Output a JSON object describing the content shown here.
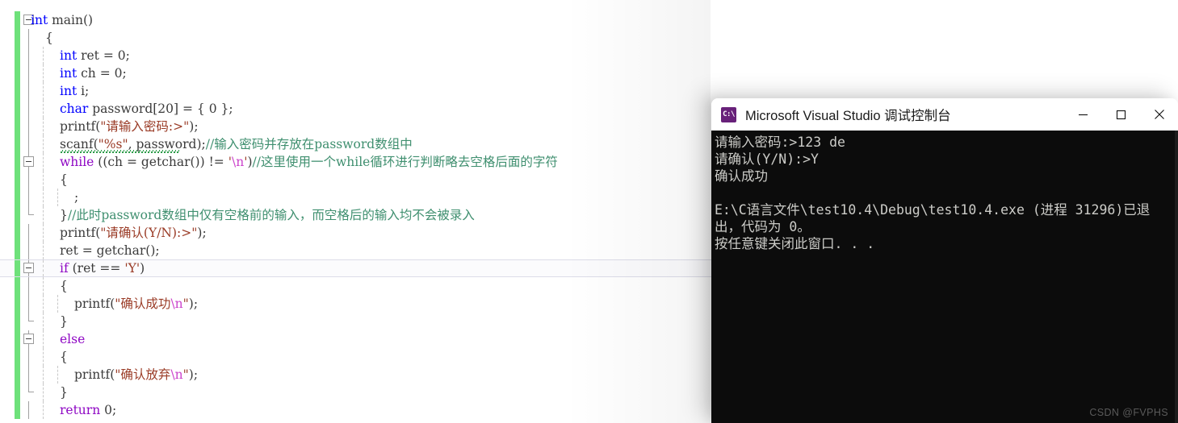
{
  "editor": {
    "name": "visual-studio-code-editor",
    "background": "#ffffff",
    "change_bar_color": "#6ee17a",
    "current_line_index": 13,
    "lines": [
      {
        "indent": 0,
        "collapse": true,
        "tokens": [
          {
            "c": "kw",
            "t": "int"
          },
          {
            "c": "plain",
            "t": " main()"
          }
        ]
      },
      {
        "indent": 1,
        "collapse": false,
        "tokens": [
          {
            "c": "plain",
            "t": "{"
          }
        ]
      },
      {
        "indent": 2,
        "collapse": false,
        "tokens": [
          {
            "c": "kw",
            "t": "int"
          },
          {
            "c": "plain",
            "t": " ret = 0;"
          }
        ]
      },
      {
        "indent": 2,
        "collapse": false,
        "tokens": [
          {
            "c": "kw",
            "t": "int"
          },
          {
            "c": "plain",
            "t": " ch = 0;"
          }
        ]
      },
      {
        "indent": 2,
        "collapse": false,
        "tokens": [
          {
            "c": "kw",
            "t": "int"
          },
          {
            "c": "plain",
            "t": " i;"
          }
        ]
      },
      {
        "indent": 2,
        "collapse": false,
        "tokens": [
          {
            "c": "kw",
            "t": "char"
          },
          {
            "c": "plain",
            "t": " password[20] = { 0 };"
          }
        ]
      },
      {
        "indent": 2,
        "collapse": false,
        "tokens": [
          {
            "c": "plain",
            "t": "printf("
          },
          {
            "c": "str",
            "t": "\"请输入密码:>\""
          },
          {
            "c": "plain",
            "t": ");"
          }
        ]
      },
      {
        "indent": 2,
        "collapse": false,
        "squiggle": true,
        "tokens": [
          {
            "c": "plain",
            "t": "scanf("
          },
          {
            "c": "str",
            "t": "\"%s\""
          },
          {
            "c": "plain",
            "t": ", password);"
          },
          {
            "c": "cmt",
            "t": "//输入密码并存放在password数组中"
          }
        ]
      },
      {
        "indent": 2,
        "collapse": true,
        "tokens": [
          {
            "c": "kwctl",
            "t": "while"
          },
          {
            "c": "plain",
            "t": " ((ch = getchar()) != "
          },
          {
            "c": "str",
            "t": "'"
          },
          {
            "c": "esc",
            "t": "\\n"
          },
          {
            "c": "str",
            "t": "'"
          },
          {
            "c": "plain",
            "t": ")"
          },
          {
            "c": "cmt",
            "t": "//这里使用一个while循环进行判断略去空格后面的字符"
          }
        ]
      },
      {
        "indent": 2,
        "collapse": false,
        "tokens": [
          {
            "c": "plain",
            "t": "{"
          }
        ]
      },
      {
        "indent": 3,
        "collapse": false,
        "tokens": [
          {
            "c": "plain",
            "t": ";"
          }
        ]
      },
      {
        "indent": 2,
        "collapse": false,
        "outline_end": true,
        "tokens": [
          {
            "c": "plain",
            "t": "}"
          },
          {
            "c": "cmt",
            "t": "//此时password数组中仅有空格前的输入，而空格后的输入均不会被录入"
          }
        ]
      },
      {
        "indent": 2,
        "collapse": false,
        "tokens": [
          {
            "c": "plain",
            "t": "printf("
          },
          {
            "c": "str",
            "t": "\"请确认(Y/N):>\""
          },
          {
            "c": "plain",
            "t": ");"
          }
        ]
      },
      {
        "indent": 2,
        "collapse": false,
        "tokens": [
          {
            "c": "plain",
            "t": "ret = getchar();"
          }
        ]
      },
      {
        "indent": 2,
        "collapse": true,
        "current": true,
        "tokens": [
          {
            "c": "kwctl",
            "t": "if"
          },
          {
            "c": "plain",
            "t": " (ret == "
          },
          {
            "c": "str",
            "t": "'Y'"
          },
          {
            "c": "plain",
            "t": ")"
          }
        ]
      },
      {
        "indent": 2,
        "collapse": false,
        "tokens": [
          {
            "c": "plain",
            "t": "{"
          }
        ]
      },
      {
        "indent": 3,
        "collapse": false,
        "tokens": [
          {
            "c": "plain",
            "t": "printf("
          },
          {
            "c": "str",
            "t": "\"确认成功"
          },
          {
            "c": "esc",
            "t": "\\n"
          },
          {
            "c": "str",
            "t": "\""
          },
          {
            "c": "plain",
            "t": ");"
          }
        ]
      },
      {
        "indent": 2,
        "collapse": false,
        "outline_end": true,
        "tokens": [
          {
            "c": "plain",
            "t": "}"
          }
        ]
      },
      {
        "indent": 2,
        "collapse": true,
        "tokens": [
          {
            "c": "kwctl",
            "t": "else"
          }
        ]
      },
      {
        "indent": 2,
        "collapse": false,
        "tokens": [
          {
            "c": "plain",
            "t": "{"
          }
        ]
      },
      {
        "indent": 3,
        "collapse": false,
        "tokens": [
          {
            "c": "plain",
            "t": "printf("
          },
          {
            "c": "str",
            "t": "\"确认放弃"
          },
          {
            "c": "esc",
            "t": "\\n"
          },
          {
            "c": "str",
            "t": "\""
          },
          {
            "c": "plain",
            "t": ");"
          }
        ]
      },
      {
        "indent": 2,
        "collapse": false,
        "outline_end": true,
        "tokens": [
          {
            "c": "plain",
            "t": "}"
          }
        ]
      },
      {
        "indent": 2,
        "collapse": false,
        "tokens": [
          {
            "c": "kwctl",
            "t": "return"
          },
          {
            "c": "plain",
            "t": " 0;"
          }
        ]
      }
    ]
  },
  "console_window": {
    "title": "Microsoft Visual Studio 调试控制台",
    "icon_label": "C:\\",
    "icon_color": "#68217a",
    "background": "#0c0c0c",
    "text_color": "#ccccc8",
    "buttons": {
      "minimize": "minimize-button",
      "maximize": "maximize-button",
      "close": "close-button"
    },
    "output_lines": [
      "请输入密码:>123 de",
      "请确认(Y/N):>Y",
      "确认成功",
      "",
      "E:\\C语言文件\\test10.4\\Debug\\test10.4.exe (进程 31296)已退",
      "出，代码为 0。",
      "按任意键关闭此窗口. . ."
    ],
    "watermark": "CSDN @FVPHS"
  }
}
